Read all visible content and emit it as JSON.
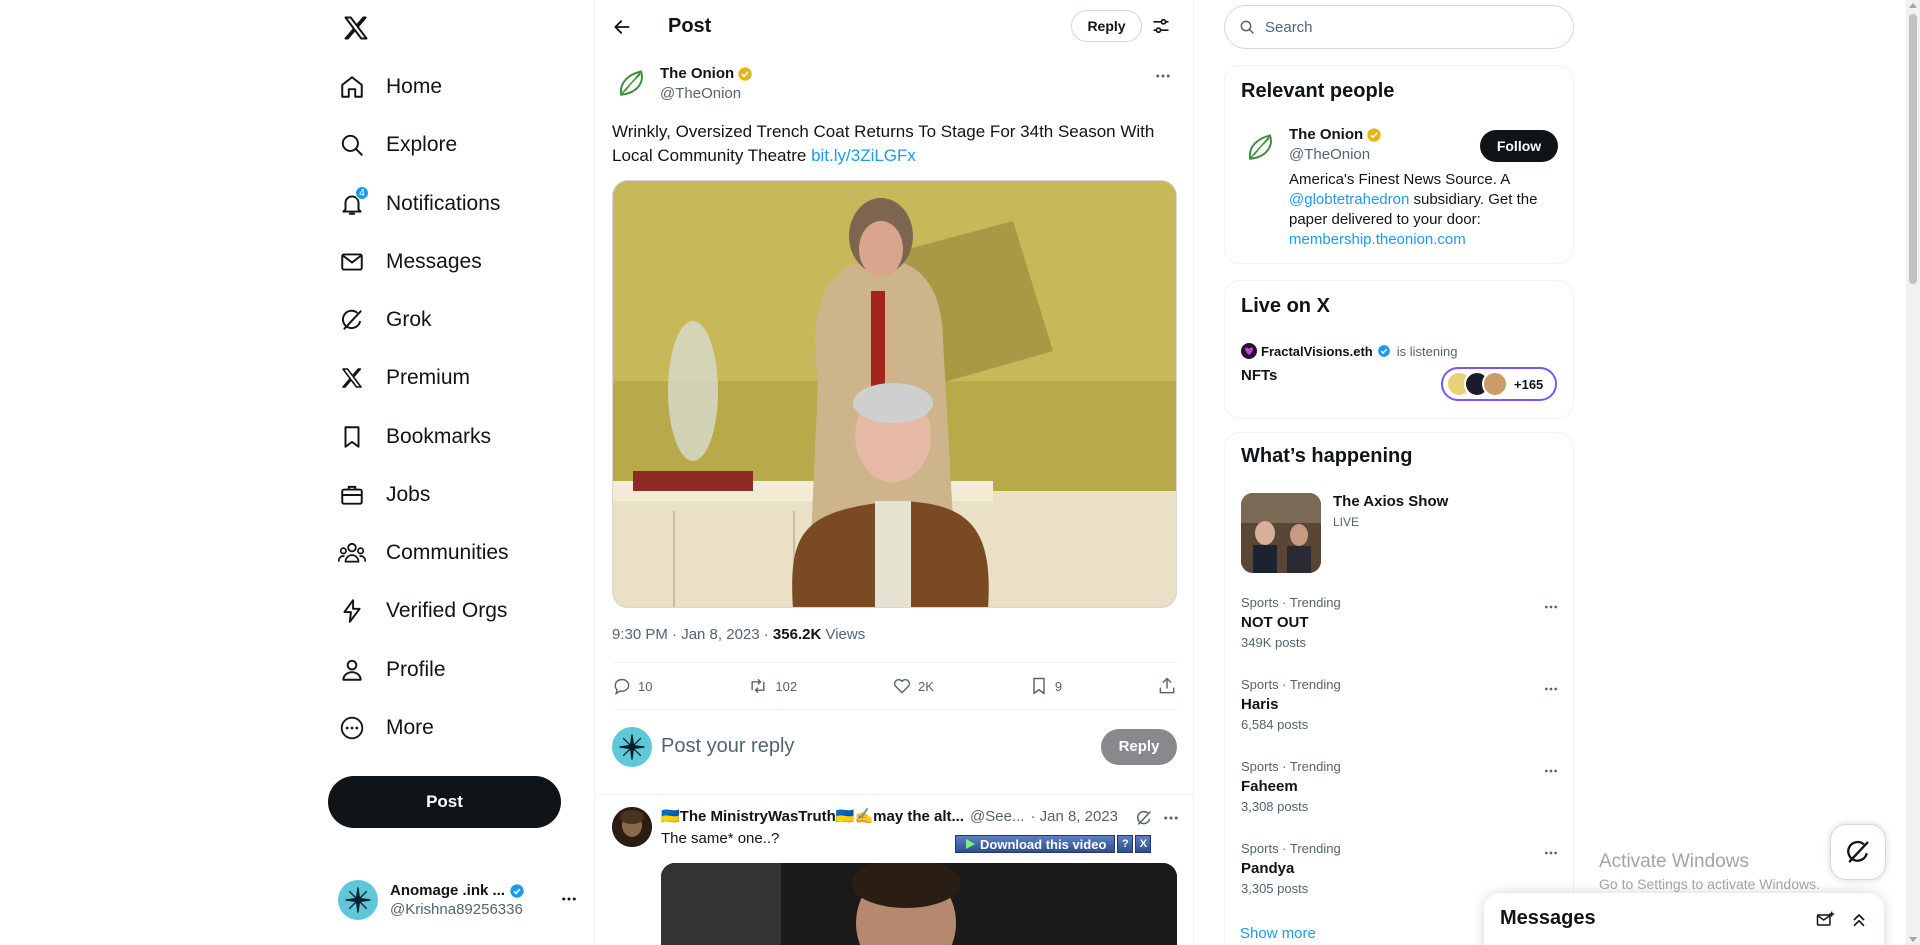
{
  "colors": {
    "accent": "#1d9bf0",
    "text": "#0f1419",
    "muted": "#536471",
    "gold_badge": "#e2b719",
    "onion_green": "#3d8f3a",
    "live_purple": "#7856ff"
  },
  "sidebar": {
    "logo": "x-logo",
    "items": [
      {
        "label": "Home",
        "icon": "home-icon"
      },
      {
        "label": "Explore",
        "icon": "search-icon"
      },
      {
        "label": "Notifications",
        "icon": "bell-icon",
        "badge": "4"
      },
      {
        "label": "Messages",
        "icon": "envelope-icon"
      },
      {
        "label": "Grok",
        "icon": "grok-icon"
      },
      {
        "label": "Premium",
        "icon": "x-logo-icon"
      },
      {
        "label": "Bookmarks",
        "icon": "bookmark-icon"
      },
      {
        "label": "Jobs",
        "icon": "briefcase-icon"
      },
      {
        "label": "Communities",
        "icon": "people-icon"
      },
      {
        "label": "Verified Orgs",
        "icon": "lightning-icon"
      },
      {
        "label": "Profile",
        "icon": "person-icon"
      },
      {
        "label": "More",
        "icon": "more-circle-icon"
      }
    ],
    "post_label": "Post",
    "account": {
      "name": "Anomage .ink ...",
      "handle": "@Krishna89256336"
    }
  },
  "header": {
    "title": "Post",
    "reply_label": "Reply"
  },
  "post": {
    "author_name": "The Onion",
    "author_handle": "@TheOnion",
    "text": "Wrinkly, Oversized Trench Coat Returns To Stage For 34th Season With Local Community Theatre ",
    "link": "bit.ly/3ZiLGFx",
    "time": "9:30 PM · Jan 8, 2023 · ",
    "views_count": "356.2K",
    "views_label": " Views",
    "stats": {
      "replies": "10",
      "reposts": "102",
      "likes": "2K",
      "bookmarks": "9"
    }
  },
  "compose": {
    "placeholder": "Post your reply",
    "button": "Reply"
  },
  "reply": {
    "name": "🇺🇦The MinistryWasTruth🇺🇦✍️may the alt...",
    "handle": "@See...",
    "date": "· Jan 8, 2023",
    "text": "The same* one..?",
    "download_label": "Download this video",
    "help_label": "?",
    "close_label": "X"
  },
  "search": {
    "placeholder": "Search"
  },
  "relevant": {
    "title": "Relevant people",
    "name": "The Onion",
    "handle": "@TheOnion",
    "follow_label": "Follow",
    "bio_1": "America's Finest News Source. A ",
    "bio_mention": "@globtetrahedron",
    "bio_2": " subsidiary. Get the paper delivered to your door: ",
    "bio_link": "membership.theonion.com"
  },
  "live": {
    "title": "Live on X",
    "host": "FractalVisions.eth",
    "status": "is listening",
    "space_title": "NFTs",
    "listener_count": "+165"
  },
  "happening": {
    "title": "What’s happening",
    "feature": {
      "name": "The Axios Show",
      "label": "LIVE"
    },
    "trends": [
      {
        "category": "Sports · Trending",
        "name": "NOT OUT",
        "posts": "349K posts"
      },
      {
        "category": "Sports · Trending",
        "name": "Haris",
        "posts": "6,584 posts"
      },
      {
        "category": "Sports · Trending",
        "name": "Faheem",
        "posts": "3,308 posts"
      },
      {
        "category": "Sports · Trending",
        "name": "Pandya",
        "posts": "3,305 posts"
      }
    ],
    "show_more": "Show more"
  },
  "messages_drawer": {
    "title": "Messages"
  },
  "watermark": {
    "line1": "Activate Windows",
    "line2": "Go to Settings to activate Windows."
  }
}
